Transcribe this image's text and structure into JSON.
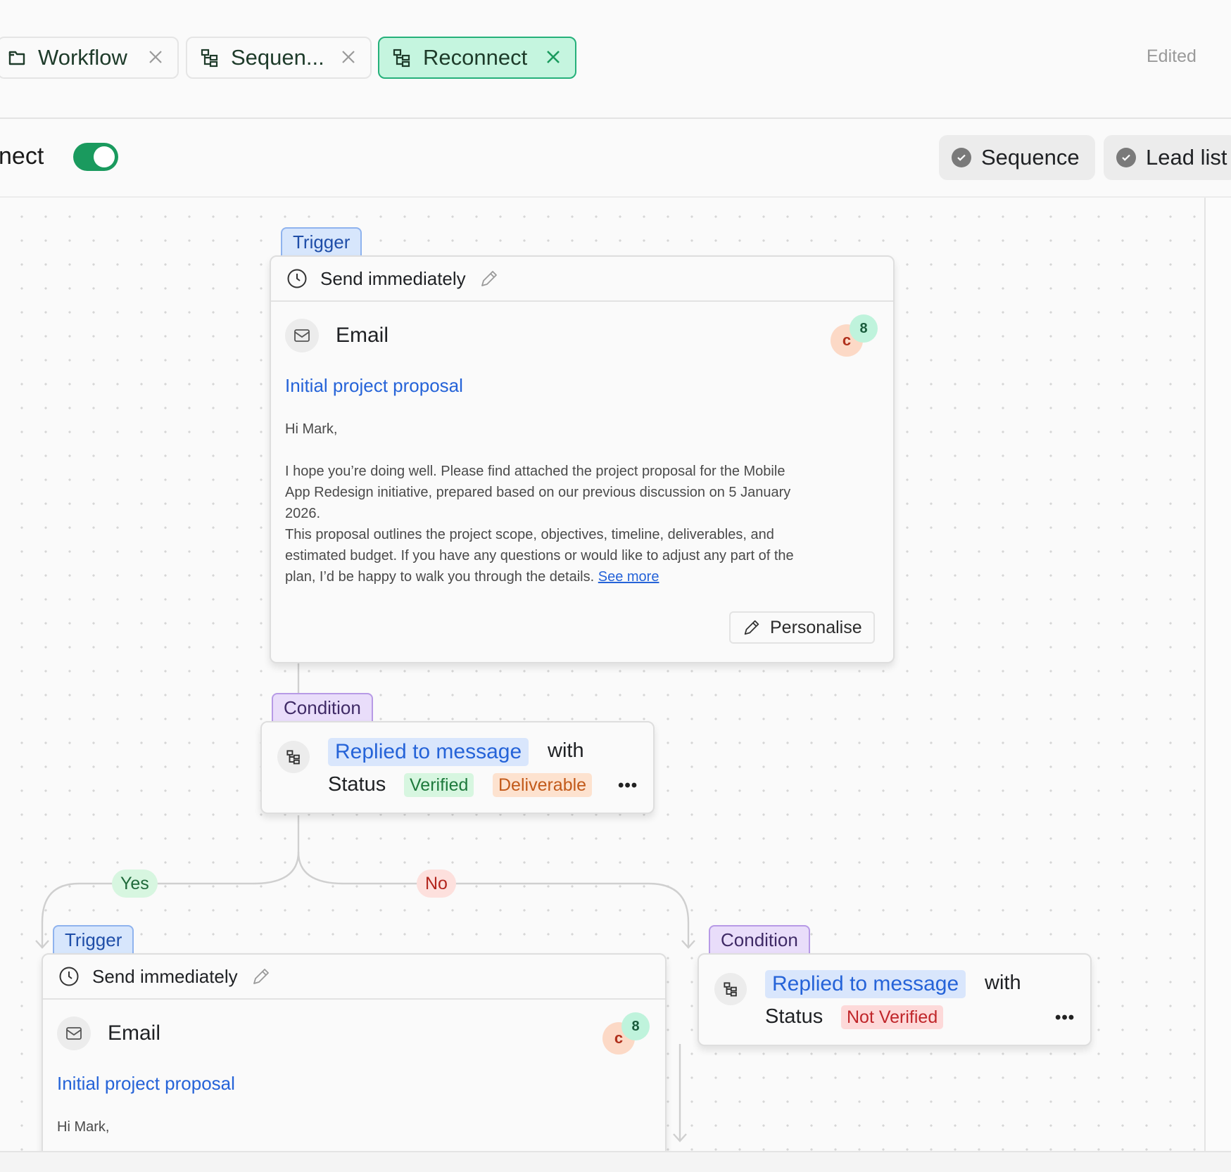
{
  "tabs": [
    {
      "label": "Workflow",
      "icon": "workflow-icon",
      "active": false
    },
    {
      "label": "Sequen...",
      "icon": "tree-icon",
      "active": false
    },
    {
      "label": "Reconnect",
      "icon": "tree-icon",
      "active": true
    }
  ],
  "header": {
    "status": "Edited"
  },
  "workflow": {
    "name_visible": "nect",
    "enabled": true
  },
  "pills": [
    {
      "label": "Sequence",
      "icon": "check-circle-icon"
    },
    {
      "label": "Lead list",
      "icon": "check-circle-icon"
    }
  ],
  "nodes": {
    "trigger1": {
      "tag": "Trigger",
      "timing": "Send immediately",
      "channel": "Email",
      "avatar": "c",
      "count": "8",
      "subject": "Initial project proposal",
      "greeting": "Hi Mark,",
      "body_lines": [
        "I hope you’re doing well. Please find attached the project proposal for the Mobile",
        "App Redesign initiative, prepared based on our previous discussion on 5 January",
        "2026.",
        "This proposal outlines the project scope, objectives, timeline, deliverables, and",
        "estimated budget. If you have any questions or would like to adjust any part of the",
        "plan, I’d be happy to walk you through the details."
      ],
      "see_more": "See more",
      "personalise": "Personalise"
    },
    "condition1": {
      "tag": "Condition",
      "event": "Replied to message",
      "with": "with",
      "status_label": "Status",
      "chips": [
        "Verified",
        "Deliverable"
      ],
      "more": "•••"
    },
    "branches": {
      "yes": "Yes",
      "no": "No"
    },
    "trigger2": {
      "tag": "Trigger",
      "timing": "Send immediately",
      "channel": "Email",
      "avatar": "c",
      "count": "8",
      "subject": "Initial project proposal",
      "greeting": "Hi Mark,"
    },
    "condition2": {
      "tag": "Condition",
      "event": "Replied to message",
      "with": "with",
      "status_label": "Status",
      "chips": [
        "Not Verified"
      ],
      "more": "•••"
    }
  },
  "colors": {
    "accent_green": "#1a9a5e",
    "active_tab_bg": "#c5f5df",
    "link_blue": "#2563d8",
    "trigger_tag": "#d7e6fc",
    "condition_tag": "#e9ddfa"
  }
}
